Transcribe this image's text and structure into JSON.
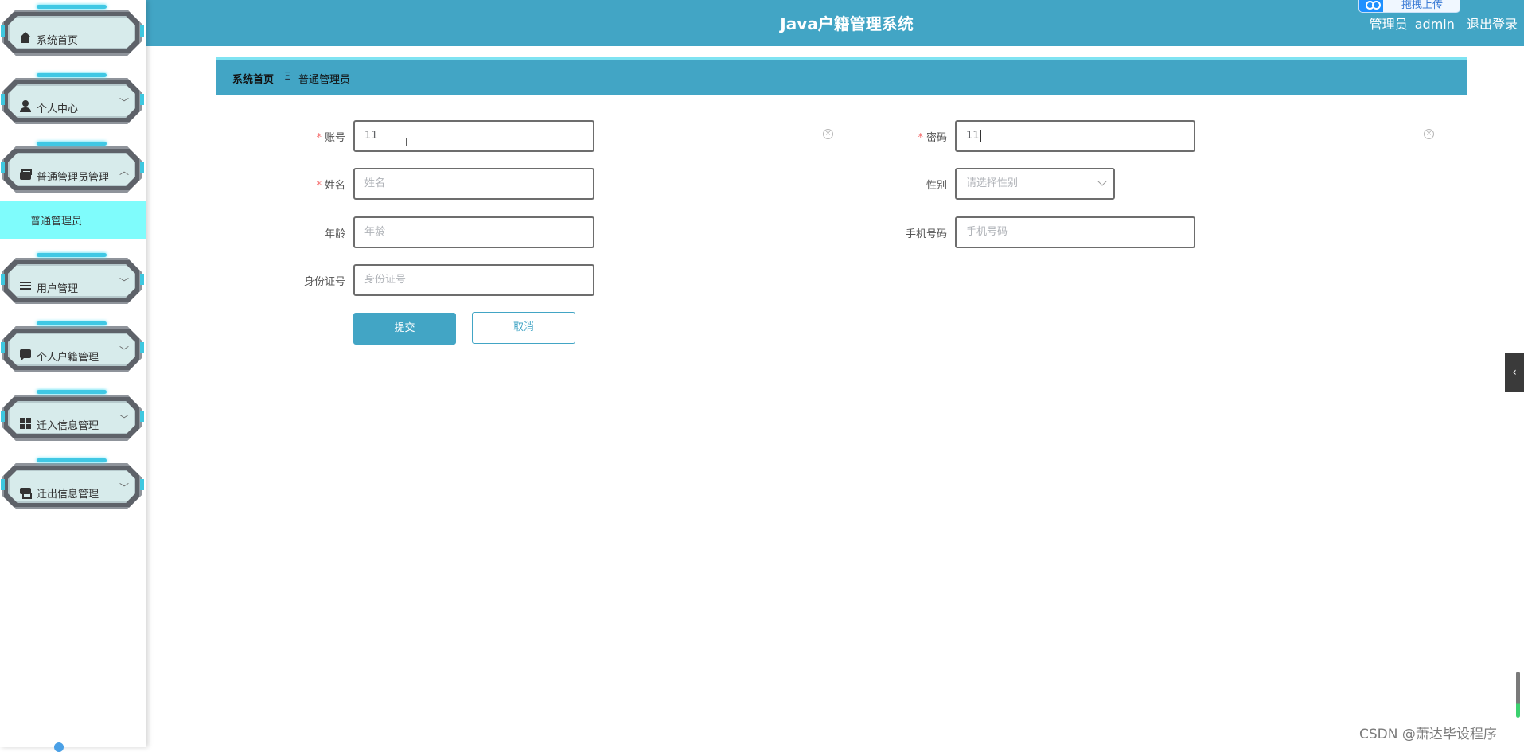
{
  "header": {
    "title": "Java户籍管理系统",
    "role_label": "管理员",
    "username": "admin",
    "logout_label": "退出登录",
    "upload_pill_label": "拖拽上传",
    "bg_color": "#42a5c5"
  },
  "sidebar": {
    "items": [
      {
        "label": "系统首页",
        "icon": "home-icon",
        "has_chevron": false
      },
      {
        "label": "个人中心",
        "icon": "user-icon",
        "chevron": "﹀"
      },
      {
        "label": "普通管理员管理",
        "icon": "wallet-icon",
        "chevron": "︿",
        "expanded": true
      },
      {
        "label": "用户管理",
        "icon": "list-icon",
        "chevron": "﹀"
      },
      {
        "label": "个人户籍管理",
        "icon": "chat-icon",
        "chevron": "﹀"
      },
      {
        "label": "迁入信息管理",
        "icon": "grid-icon",
        "chevron": "﹀"
      },
      {
        "label": "迁出信息管理",
        "icon": "printer-icon",
        "chevron": "﹀"
      }
    ],
    "active_sub_item": "普通管理员",
    "active_sub_color": "#7ffcfc"
  },
  "breadcrumb": {
    "home": "系统首页",
    "separator": "Ξ",
    "current": "普通管理员"
  },
  "form": {
    "account": {
      "label": "账号",
      "required": true,
      "value": "11"
    },
    "password": {
      "label": "密码",
      "required": true,
      "value": "11"
    },
    "name": {
      "label": "姓名",
      "required": true,
      "placeholder": "姓名"
    },
    "gender": {
      "label": "性别",
      "placeholder": "请选择性别"
    },
    "age": {
      "label": "年龄",
      "placeholder": "年龄"
    },
    "phone": {
      "label": "手机号码",
      "placeholder": "手机号码"
    },
    "id_number": {
      "label": "身份证号",
      "placeholder": "身份证号"
    },
    "required_mark": "*",
    "clear_glyph": "×",
    "submit_label": "提交",
    "cancel_label": "取消"
  },
  "misc": {
    "collapse_glyph": "‹",
    "watermark": "CSDN @萧达毕设程序"
  }
}
